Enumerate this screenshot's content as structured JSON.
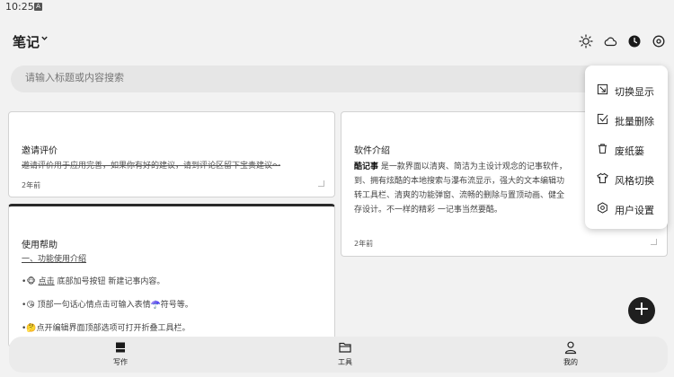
{
  "status_bar": {
    "time": "10:25",
    "notification_icon": "a-square-icon"
  },
  "app_bar": {
    "title": "笔记",
    "icons": [
      "brightness-icon",
      "cloud-icon",
      "clock-icon",
      "target-icon"
    ]
  },
  "search": {
    "placeholder": "请输入标题或内容搜索",
    "value": ""
  },
  "notes": [
    {
      "title": "邀请评价",
      "body": "邀请评价用于应用完善，如果你有好的建议，请到评论区留下宝贵建议～",
      "time": "2年前",
      "strikethrough": true
    },
    {
      "title": "软件介绍",
      "body_bold": "酷记事",
      "body_lines": [
        "是一款界面以清爽、简洁为主设计观念的记事软件，",
        "到、拥有炫酷的本地搜索与瀑布流显示，强大的文本编辑功",
        "转工具栏、清爽的功能弹窗、流畅的删除与置顶动画、健全",
        "存设计。不一样的精彩 一记事当然要酷。"
      ],
      "time": "2年前"
    },
    {
      "title": "使用帮助",
      "subtitle": "一、功能使用介绍",
      "items": [
        {
          "emoji": "🐵",
          "link": "点击",
          "text": "底部加号按钮 新建记事内容。"
        },
        {
          "emoji": "😘",
          "text": "顶部一句话心情点击可输入表情☂️符号等。"
        },
        {
          "emoji": "🤔",
          "text": "点开编辑界面顶部选项可打开折叠工具栏。"
        }
      ]
    }
  ],
  "menu": {
    "items": [
      {
        "label": "切换显示",
        "icon": "switch-view-icon"
      },
      {
        "label": "批量删除",
        "icon": "checkbox-icon"
      },
      {
        "label": "废纸篓",
        "icon": "trash-icon"
      },
      {
        "label": "风格切换",
        "icon": "shirt-icon"
      },
      {
        "label": "用户设置",
        "icon": "settings-icon"
      }
    ]
  },
  "fab": {
    "label": "+"
  },
  "bottom_nav": [
    {
      "label": "写作",
      "icon": "write-icon",
      "active": true
    },
    {
      "label": "工具",
      "icon": "folder-icon",
      "active": false
    },
    {
      "label": "我的",
      "icon": "user-icon",
      "active": false
    }
  ]
}
